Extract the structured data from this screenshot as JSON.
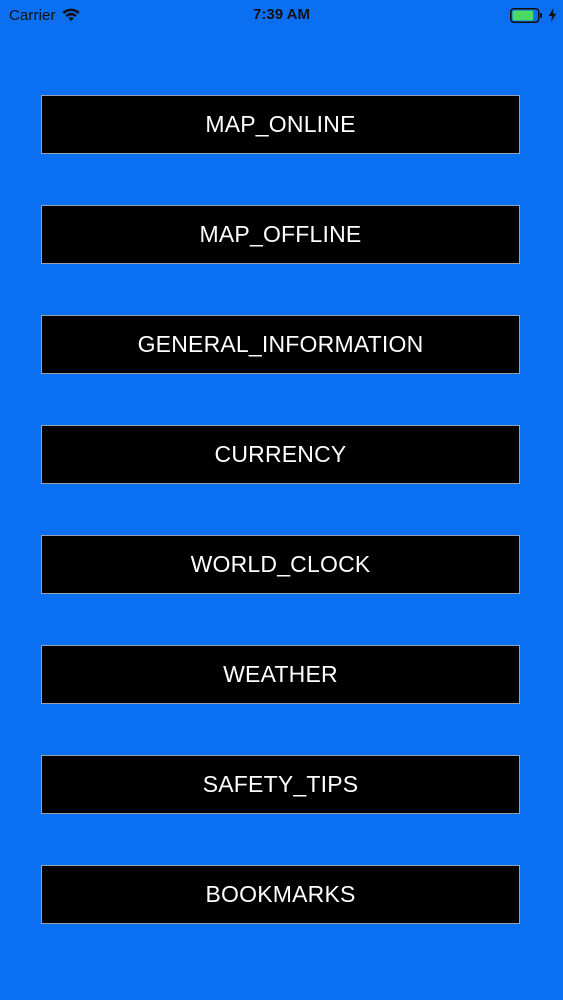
{
  "status_bar": {
    "carrier": "Carrier",
    "time": "7:39 AM",
    "wifi_icon": "wifi-icon",
    "battery_icon": "battery-icon",
    "charging_icon": "charging-bolt-icon",
    "battery_level": 0.85
  },
  "colors": {
    "background": "#0a6ff0",
    "button_background": "#000000",
    "button_text": "#ffffff",
    "battery_fill": "#4cd964"
  },
  "menu": {
    "items": [
      {
        "label": "MAP_ONLINE"
      },
      {
        "label": "MAP_OFFLINE"
      },
      {
        "label": "GENERAL_INFORMATION"
      },
      {
        "label": "CURRENCY"
      },
      {
        "label": "WORLD_CLOCK"
      },
      {
        "label": "WEATHER"
      },
      {
        "label": "SAFETY_TIPS"
      },
      {
        "label": "BOOKMARKS"
      }
    ]
  }
}
